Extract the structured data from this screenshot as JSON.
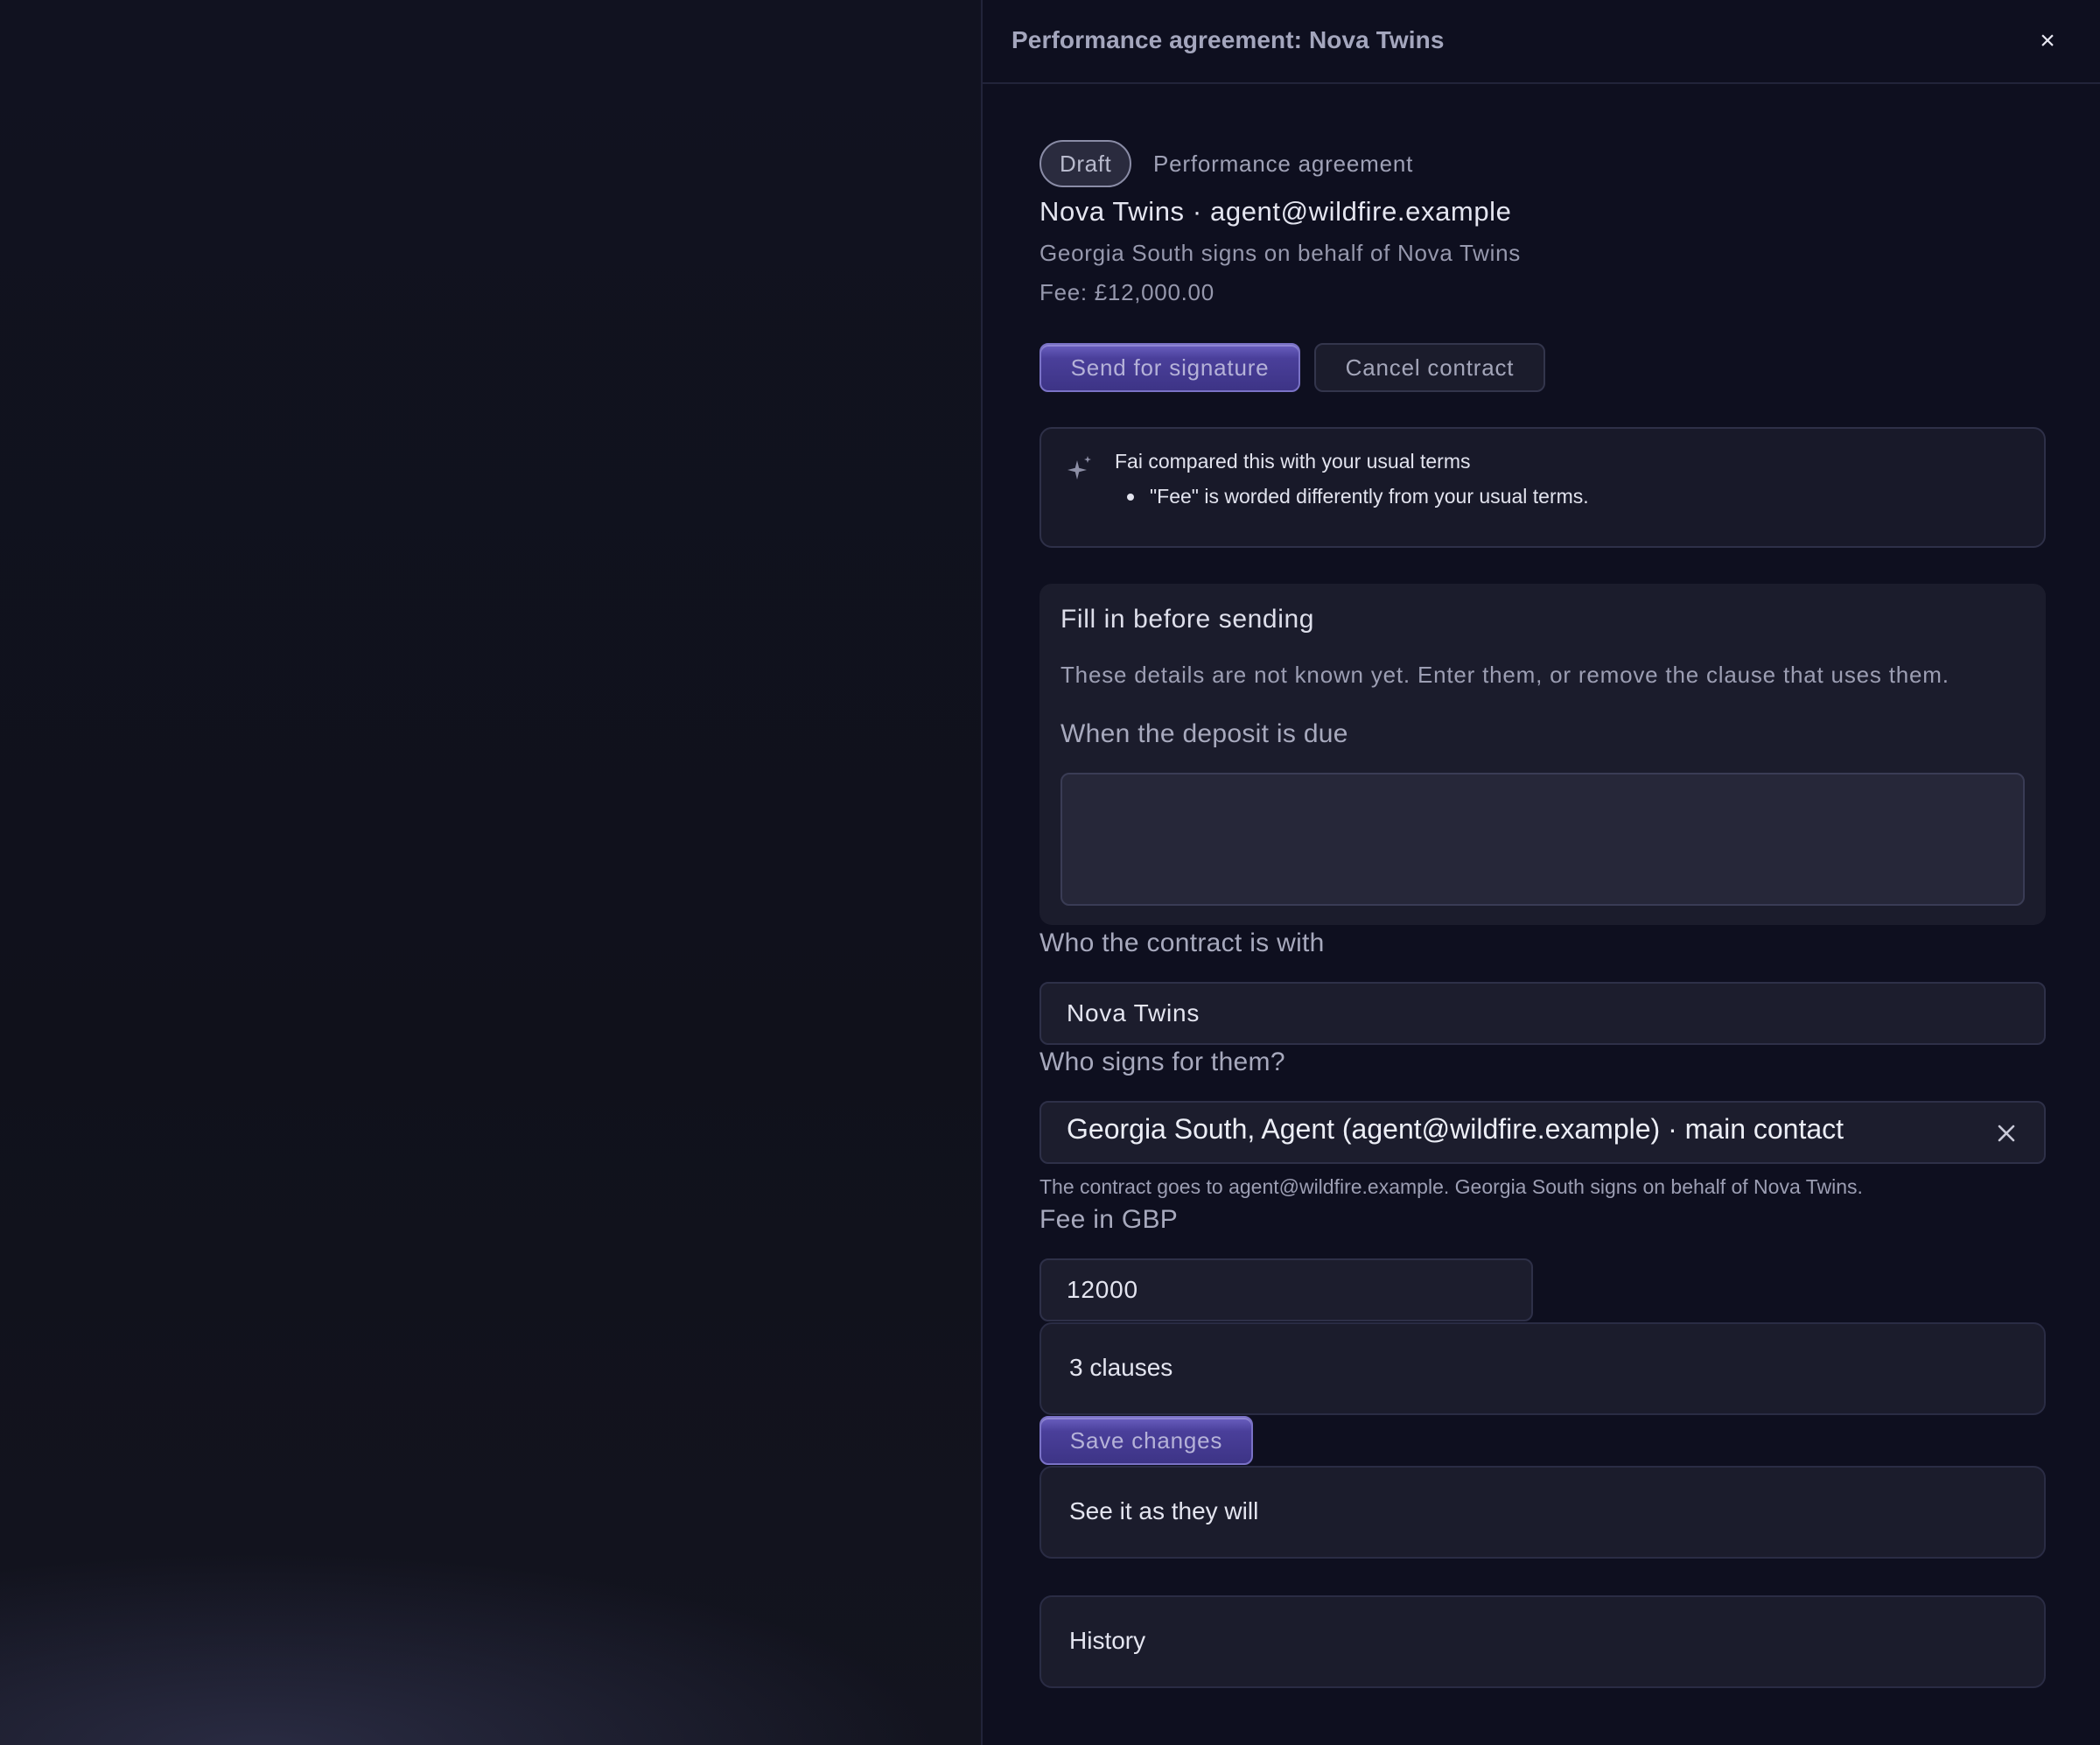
{
  "drawer": {
    "title": "Performance agreement: Nova Twins",
    "close_glyph": "×"
  },
  "summary": {
    "status_badge": "Draft",
    "document_type": "Performance agreement",
    "party_line": "Nova Twins · agent@wildfire.example",
    "signer_line": "Georgia South signs on behalf of Nova Twins",
    "fee_line": "Fee: £12,000.00"
  },
  "actions": {
    "send_label": "Send for signature",
    "cancel_label": "Cancel contract"
  },
  "ai_check": {
    "icon": "sparkle-icon",
    "title": "Fai compared this with your usual terms",
    "bullets": [
      "\"Fee\" is worded differently from your usual terms."
    ]
  },
  "fill_in": {
    "title": "Fill in before sending",
    "description": "These details are not known yet. Enter them, or remove the clause that uses them.",
    "deposit_label": "When the deposit is due",
    "deposit_value": ""
  },
  "form": {
    "party_label": "Who the contract is with",
    "party_value": "Nova Twins",
    "signer_label": "Who signs for them?",
    "signer_value": "Georgia South, Agent (agent@wildfire.example) · main contact",
    "signer_helper": "The contract goes to agent@wildfire.example. Georgia South signs on behalf of Nova Twins.",
    "fee_label": "Fee in GBP",
    "fee_value": "12000"
  },
  "sections": {
    "clauses_label": "3 clauses",
    "save_label": "Save changes",
    "preview_label": "See it as they will",
    "history_label": "History"
  },
  "colors": {
    "accent": "#4a3f9a",
    "drawer_bg": "#0e0f1f",
    "panel_bg": "#1b1c2c"
  }
}
